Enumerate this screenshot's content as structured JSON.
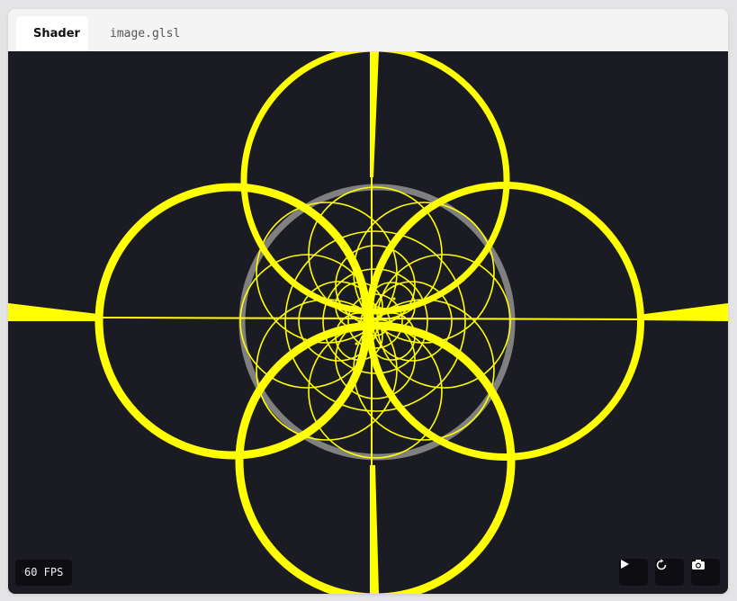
{
  "tabs": [
    {
      "label": "Shader",
      "active": true
    },
    {
      "label": "image.glsl",
      "active": false
    }
  ],
  "canvas": {
    "background": "#1b1b24",
    "accent": "#ffff00",
    "ring_color": "#808080"
  },
  "status": {
    "fps_label": "60 FPS"
  },
  "controls": {
    "play_icon": "play-icon",
    "reset_icon": "restart-icon",
    "screenshot_icon": "camera-icon"
  }
}
